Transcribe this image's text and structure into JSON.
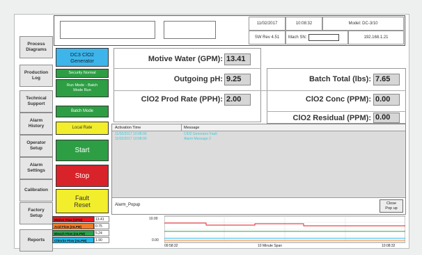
{
  "nav": [
    {
      "id": "process-diagrams",
      "label": "Process\nDiagrams"
    },
    {
      "id": "production-log",
      "label": "Production\nLog"
    },
    {
      "id": "technical-support",
      "label": "Technical\nSupport"
    },
    {
      "id": "alarm-history",
      "label": "Alarm\nHistory"
    },
    {
      "id": "operator-setup",
      "label": "Operator\nSetup"
    },
    {
      "id": "alarm-settings",
      "label": "Alarm\nSettings"
    },
    {
      "id": "calibration",
      "label": "Calibration"
    },
    {
      "id": "factory-setup",
      "label": "Factory\nSetup"
    },
    {
      "id": "reports",
      "label": "Reports"
    }
  ],
  "header": {
    "date": "11/02/2017",
    "time": "10:08:32",
    "model": "Model: DC-3/10",
    "sw_rev": "SW Rev 4.51",
    "mach_sn_label": "Mach SN:",
    "mach_sn_value": "",
    "ip": "192.168.1.21"
  },
  "controls": {
    "generator": "DC3 ClO2\nGenerator",
    "security": "Security Normal",
    "run_mode": "Run Mode - Batch\nMode Run",
    "batch_mode": "Batch Mode",
    "local_rate": "Local Rate",
    "start": "Start",
    "stop": "Stop",
    "fault_reset": "Fault\nReset"
  },
  "metrics": {
    "motive_water_label": "Motive Water  (GPM):",
    "motive_water_value": "13.41",
    "outgoing_ph_label": "Outgoing pH:",
    "outgoing_ph_value": "9.25",
    "clo2_prod_label": "ClO2 Prod Rate (PPH):",
    "clo2_prod_value": "2.00",
    "batch_total_label": "Batch Total (lbs):",
    "batch_total_value": "7.65",
    "clo2_conc_label": "ClO2 Conc (PPM):",
    "clo2_conc_value": "0.00",
    "clo2_residual_label": "ClO2 Residual (PPM):",
    "clo2_residual_value": "0.00"
  },
  "alarm": {
    "col_time": "Activation Time",
    "col_message": "Message",
    "rows": [
      {
        "time": "11/02/2017 10:08:00",
        "message": "ClO2 Generator Fault"
      },
      {
        "time": "11/02/2017 10:08:00",
        "message": "Alarm Message 2"
      }
    ],
    "popup_label": "Alarm_Popup",
    "close_label": "Close\nPop up"
  },
  "legend": [
    {
      "name": "Motive Flow (GPM)",
      "value": "13.41",
      "color": "#e8141e"
    },
    {
      "name": "Acid Flow (mLPM)",
      "value": "0.75",
      "color": "#f07b2a"
    },
    {
      "name": "Bleach Flow (mLPM)",
      "value": "5.24",
      "color": "#27a34a"
    },
    {
      "name": "Chlorite Flow (mLPM)",
      "value": "1.90",
      "color": "#1fb7e8"
    }
  ],
  "trend": {
    "ytick_top": "10.00",
    "ytick_bottom": "0.00",
    "x_start": "09:58:32",
    "x_mid": "10 Minute Span",
    "x_end": "10:08:32"
  },
  "colors": {
    "generator_blue": "#3db5ea",
    "green": "#2e9e45",
    "yellow": "#f2ee2b",
    "red": "#d8232a",
    "alarm_text": "#3ec9d6"
  }
}
